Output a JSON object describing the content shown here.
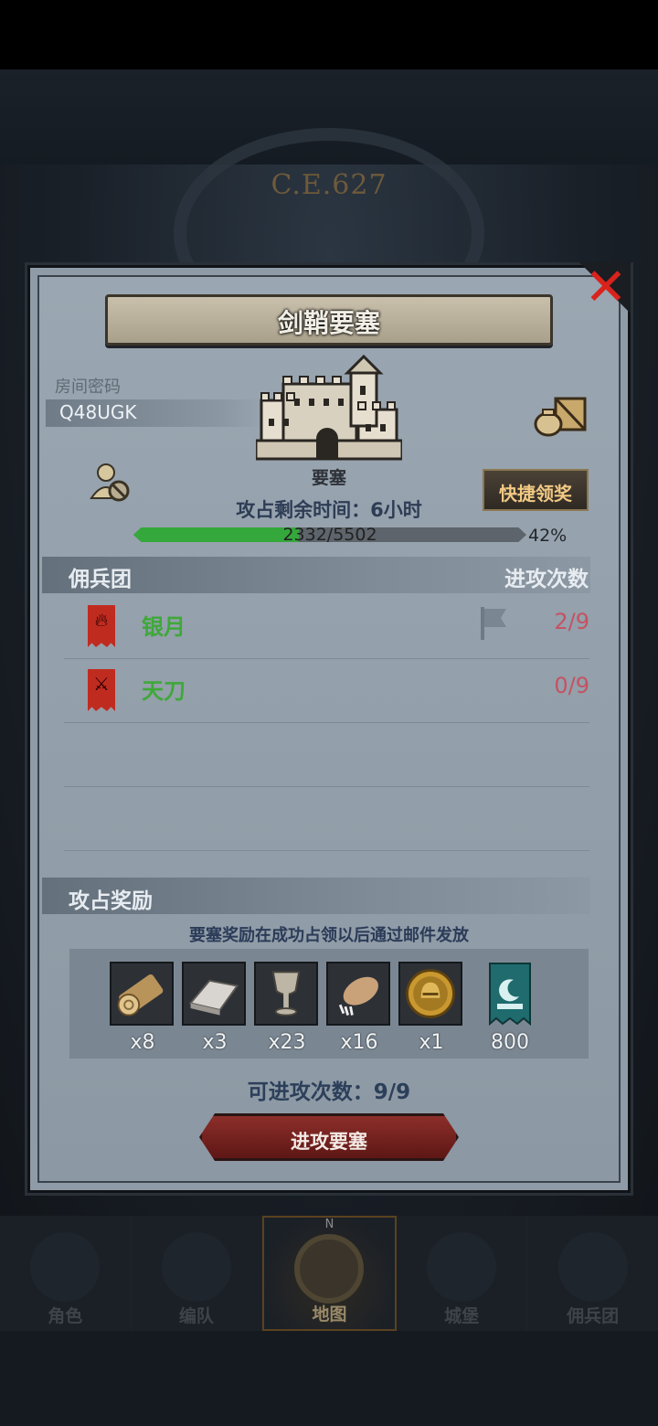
{
  "background": {
    "era_label": "C.E.627"
  },
  "dialog": {
    "title": "剑鞘要塞",
    "close_icon": "close-x-icon",
    "room": {
      "label": "房间密码",
      "code": "Q48UGK"
    },
    "fortress_label": "要塞",
    "time_text": "攻占剩余时间：6小时",
    "quick_claim_label": "快捷领奖",
    "progress": {
      "text": "2332/5502",
      "percent_text": "42%",
      "fraction": 0.42
    },
    "mercenaries": {
      "header": "佣兵团",
      "count_header": "进攻次数",
      "rows": [
        {
          "name": "银月",
          "count": "2/9",
          "banner_icon": "fire-emblem-icon",
          "flag": true
        },
        {
          "name": "天刀",
          "count": "0/9",
          "banner_icon": "sword-emblem-icon",
          "flag": false
        }
      ]
    },
    "rewards": {
      "header": "攻占奖励",
      "hint": "要塞奖励在成功占领以后通过邮件发放",
      "items": [
        {
          "icon": "wood-log-icon",
          "qty": "x8"
        },
        {
          "icon": "iron-ingot-icon",
          "qty": "x3"
        },
        {
          "icon": "goblet-icon",
          "qty": "x23"
        },
        {
          "icon": "fur-pelt-icon",
          "qty": "x16"
        },
        {
          "icon": "helmet-coin-icon",
          "qty": "x1"
        },
        {
          "icon": "guild-banner-icon",
          "qty": "800"
        }
      ]
    },
    "attacks_left_text": "可进攻次数：9/9",
    "attack_button": "进攻要塞"
  },
  "nav": {
    "items": [
      {
        "label": "角色",
        "icon": "knight-icon",
        "active": false
      },
      {
        "label": "编队",
        "icon": "helmet-squad-icon",
        "active": false
      },
      {
        "label": "地图",
        "icon": "compass-map-icon",
        "active": true
      },
      {
        "label": "城堡",
        "icon": "castle-icon",
        "active": false
      },
      {
        "label": "佣兵团",
        "icon": "ship-icon",
        "active": false
      }
    ],
    "compass_letter": "N"
  },
  "colors": {
    "accent_gold": "#f1c983",
    "progress_green": "#35a83c",
    "danger_red": "#d8231c",
    "guild_green": "#3fa83a",
    "count_red": "#c45363"
  }
}
